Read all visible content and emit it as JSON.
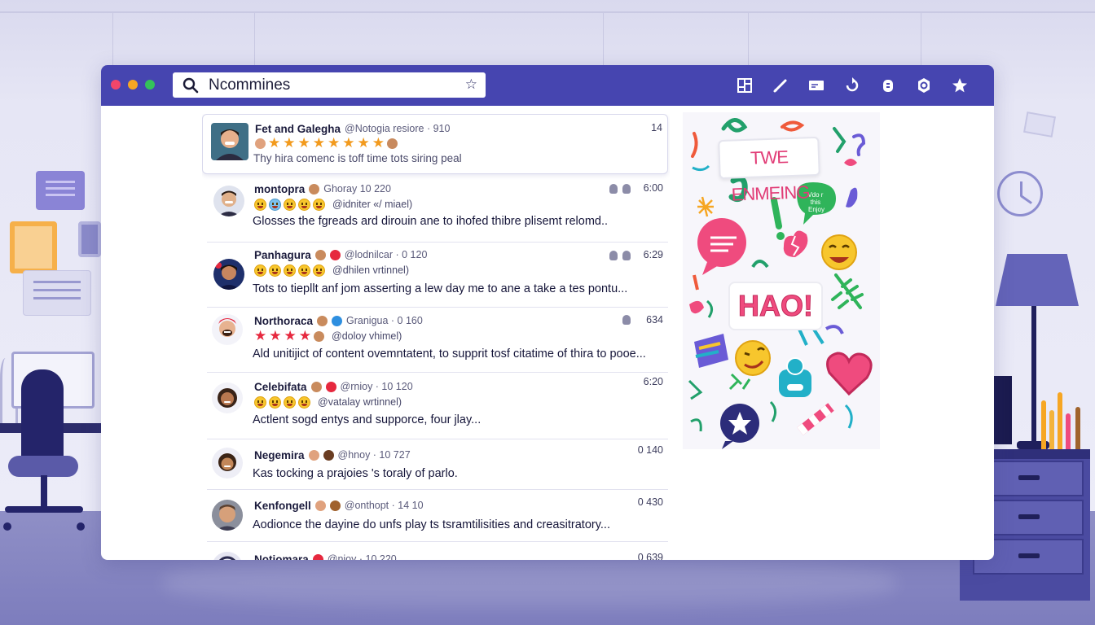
{
  "search": {
    "value": "Ncommines"
  },
  "toolbar": {
    "icons": [
      "layout-icon",
      "pen-icon",
      "card-icon",
      "refresh-icon",
      "lock-icon",
      "settings-icon",
      "star-icon"
    ]
  },
  "posts": [
    {
      "name": "Fet and Galegha",
      "handle": "@Notogia resiore · 910",
      "time": "14",
      "body": "Thy hira comenc is toff time tots siring peal"
    },
    {
      "name": "montopra",
      "handle": "Ghoray 10 220",
      "sub": "@idniter «/ miael)",
      "time": "6:00",
      "body": "Glosses the fgreads ard dirouin ane to ihofed thibre plisemt relomd.."
    },
    {
      "name": "Panhagura",
      "handle": "@lodnilcar · 0 120",
      "sub": "@dhilen vrtinnel)",
      "time": "6:29",
      "body": "Tots to tiepllt anf jom asserting a lew day me to ane a take a tes pontu..."
    },
    {
      "name": "Northoraca",
      "handle": "Granigua · 0 160",
      "sub": "@doloy vhimel)",
      "time": "634",
      "body": "Ald unitijict of content ovemntatent, to supprit tosf citatime of thira to pooe..."
    },
    {
      "name": "Celebifata",
      "handle": "@rnioy · 10 120",
      "sub": "@vatalay wrtinnel)",
      "time": "6:20",
      "body": "Actlent sogd entys and supporce, four jlay..."
    },
    {
      "name": "Negemira",
      "handle": "@hnoy · 10 727",
      "time": "0 140",
      "body": "Kas tocking a prajoies 's toraly of parlo."
    },
    {
      "name": "Kenfongell",
      "handle": "@onthopt · 14 10",
      "time": "0 430",
      "body": "Aodionce the dayine do unfs play ts tsramtilisities and creasitratory..."
    },
    {
      "name": "Notiomara",
      "handle": "@nioy · 10 220",
      "time": "0 639",
      "body": ""
    }
  ],
  "poster": {
    "title": "TWE ENMEING",
    "exclaim": "HAO!",
    "bubble_text": "Vdo r this Enjoy"
  },
  "colors": {
    "titlebar": "#4645b0",
    "star": "#f29a1d",
    "red_star": "#e6283e",
    "poster_pink": "#ef4b7e"
  }
}
